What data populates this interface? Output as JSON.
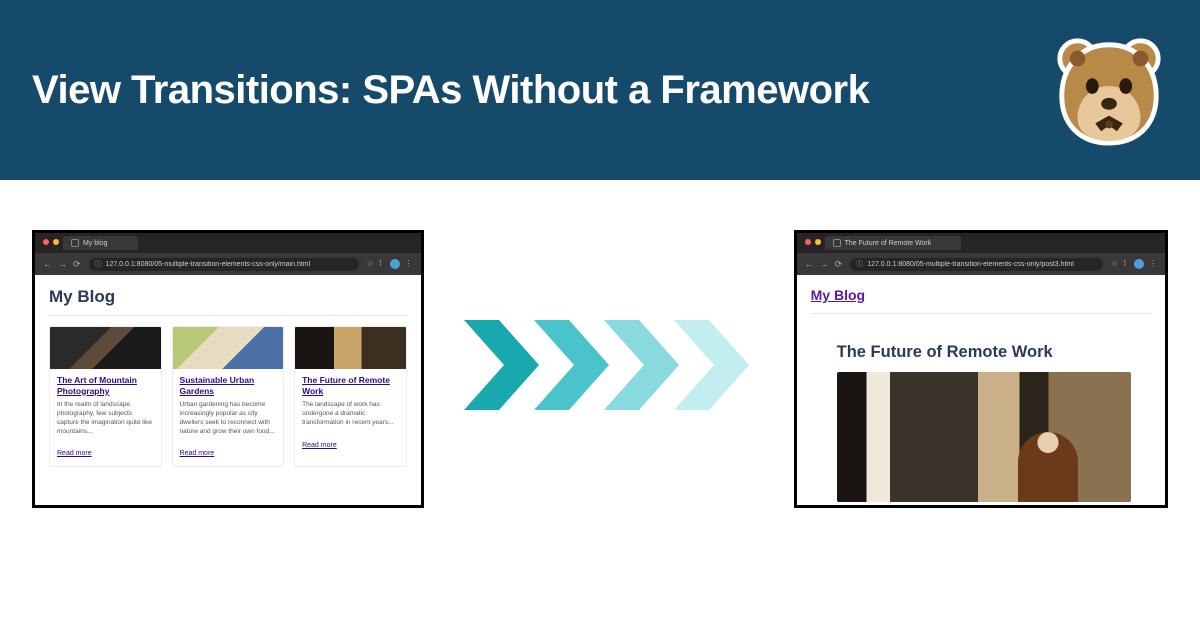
{
  "hero": {
    "title": "View Transitions: SPAs Without a Framework"
  },
  "browsers": {
    "left": {
      "tab": "My blog",
      "url": "127.0.0.1:8080/05-multiple-transition-elements-css-only/main.html",
      "page_title": "My Blog",
      "cards": [
        {
          "title": "The Art of Mountain Photography",
          "excerpt": "In the realm of landscape photography, few subjects capture the imagination quite like mountains...",
          "more": "Read more"
        },
        {
          "title": "Sustainable Urban Gardens",
          "excerpt": "Urban gardening has become increasingly popular as city dwellers seek to reconnect with nature and grow their own food...",
          "more": "Read more"
        },
        {
          "title": "The Future of Remote Work",
          "excerpt": "The landscape of work has undergone a dramatic transformation in recent years...",
          "more": "Read more"
        }
      ]
    },
    "right": {
      "tab": "The Future of Remote Work",
      "url": "127.0.0.1:8080/05-multiple-transition-elements-css-only/post3.html",
      "home_link": "My Blog",
      "post_title": "The Future of Remote Work"
    }
  },
  "colors": {
    "header_bg": "#164a6b",
    "link": "#2b0a8a",
    "arrow_base": "#26b7bd"
  }
}
